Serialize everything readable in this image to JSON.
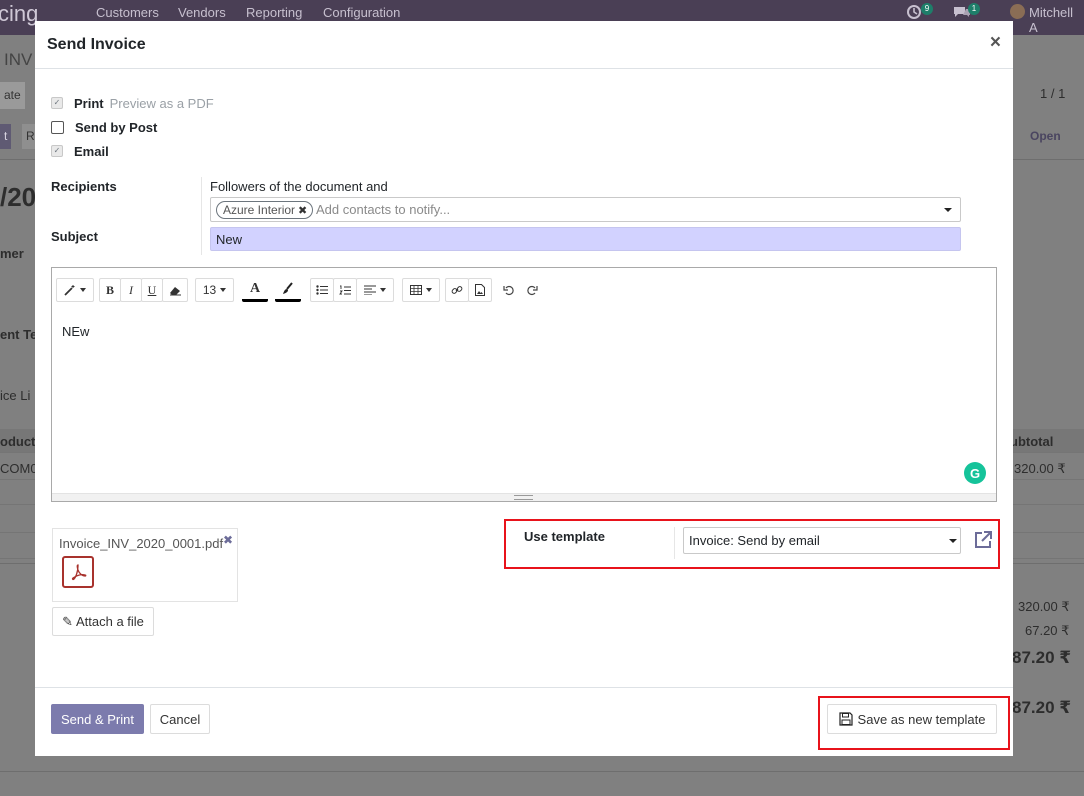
{
  "navbar": {
    "brand": "cing",
    "menu": [
      "Customers",
      "Vendors",
      "Reporting",
      "Configuration"
    ],
    "activity_count": "9",
    "message_count": "1",
    "user": "Mitchell A"
  },
  "background": {
    "breadcrumb": "INV",
    "left_button": "ate",
    "pager": "1 / 1",
    "stage_buttons": [
      "t",
      "R"
    ],
    "status": "Open",
    "doc_title": "/20",
    "customer_label": "mer",
    "payment_terms_label": "ent Te",
    "tab_label": "ice Li",
    "col_product": "oduct",
    "col_subtotal": "ubtotal",
    "row_product": "COM0",
    "row_subtotal": "320.00 ₹",
    "untaxed": "320.00 ₹",
    "tax": "67.20 ₹",
    "total": "87.20 ₹",
    "amount_due": "87.20 ₹"
  },
  "modal": {
    "title": "Send Invoice",
    "close_symbol": "×",
    "options": {
      "print_label": "Print",
      "print_hint": "Preview as a PDF",
      "post_label": "Send by Post",
      "email_label": "Email"
    },
    "recipients": {
      "label": "Recipients",
      "note": "Followers of the document and",
      "tags": [
        "Azure Interior"
      ],
      "placeholder": "Add contacts to notify..."
    },
    "subject": {
      "label": "Subject",
      "value": "New"
    },
    "editor": {
      "font_size": "13",
      "text_color_glyph": "A",
      "body": "NEw",
      "grammarly": "G"
    },
    "attachment": {
      "filename": "Invoice_INV_2020_0001.pdf",
      "remove_symbol": "✖",
      "attach_button": "Attach a file"
    },
    "template": {
      "label": "Use template",
      "value": "Invoice: Send by email"
    },
    "footer": {
      "send_print": "Send & Print",
      "cancel": "Cancel",
      "save_template": "Save as new template"
    },
    "highlight_color": "#e8131b",
    "primary_color": "#7c7bad"
  }
}
